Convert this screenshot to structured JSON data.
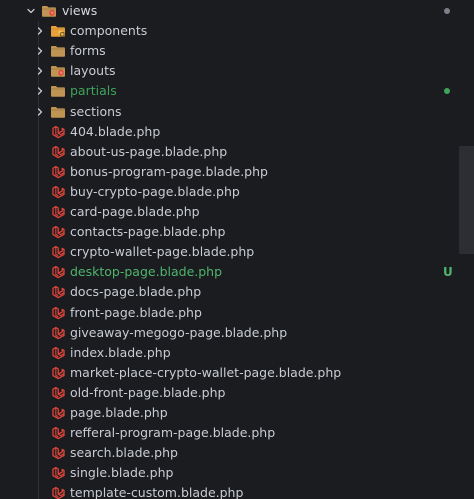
{
  "root": {
    "label": "views",
    "icon": "laravel-folder-icon"
  },
  "folders": [
    {
      "label": "components",
      "icon": "folder-components-icon"
    },
    {
      "label": "forms",
      "icon": "folder-icon"
    },
    {
      "label": "layouts",
      "icon": "laravel-folder-icon"
    },
    {
      "label": "partials",
      "icon": "folder-icon",
      "status": "modified"
    },
    {
      "label": "sections",
      "icon": "folder-icon"
    }
  ],
  "files": [
    {
      "label": "404.blade.php"
    },
    {
      "label": "about-us-page.blade.php"
    },
    {
      "label": "bonus-program-page.blade.php"
    },
    {
      "label": "buy-crypto-page.blade.php"
    },
    {
      "label": "card-page.blade.php"
    },
    {
      "label": "contacts-page.blade.php"
    },
    {
      "label": "crypto-wallet-page.blade.php"
    },
    {
      "label": "desktop-page.blade.php",
      "git_status": "U"
    },
    {
      "label": "docs-page.blade.php"
    },
    {
      "label": "front-page.blade.php"
    },
    {
      "label": "giveaway-megogo-page.blade.php"
    },
    {
      "label": "index.blade.php"
    },
    {
      "label": "market-place-crypto-wallet-page.blade.php"
    },
    {
      "label": "old-front-page.blade.php"
    },
    {
      "label": "page.blade.php"
    },
    {
      "label": "refferal-program-page.blade.php"
    },
    {
      "label": "search.blade.php"
    },
    {
      "label": "single.blade.php"
    },
    {
      "label": "template-custom.blade.php"
    }
  ],
  "colors": {
    "background": "#1b1c20",
    "text": "#c9cdd3",
    "untracked_green": "#4fb56d",
    "modified_green": "#3fa35a",
    "root_dot": "#7d8088",
    "laravel_red": "#e0453b",
    "folder_tan": "#c09553",
    "folder_orange": "#e8a13a"
  }
}
